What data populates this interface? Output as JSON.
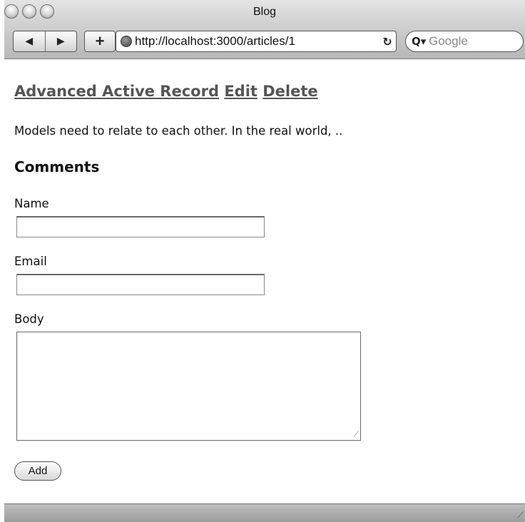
{
  "window": {
    "title": "Blog"
  },
  "toolbar": {
    "back_icon": "◀",
    "forward_icon": "▶",
    "add_icon": "+",
    "url": "http://localhost:3000/articles/1",
    "reload_icon": "↻",
    "search_icon": "Q▾",
    "search_placeholder": "Google"
  },
  "article": {
    "title": "Advanced Active Record",
    "edit_link": "Edit",
    "delete_link": "Delete",
    "summary": "Models need to relate to each other. In the real world, .."
  },
  "comments": {
    "heading": "Comments",
    "name_label": "Name",
    "name_value": "",
    "email_label": "Email",
    "email_value": "",
    "body_label": "Body",
    "body_value": "",
    "submit_label": "Add"
  }
}
